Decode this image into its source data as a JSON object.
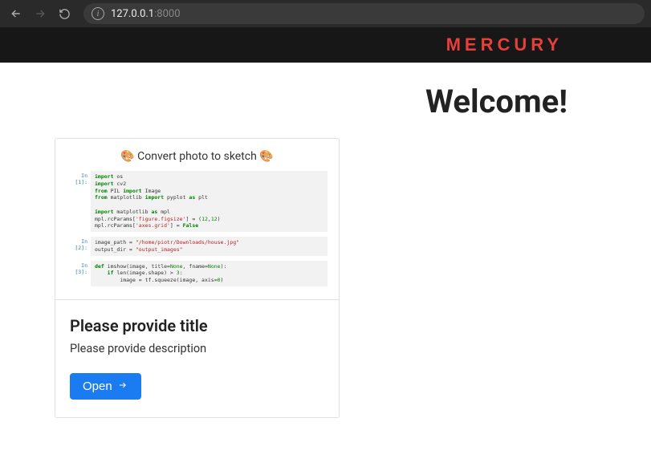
{
  "browser": {
    "url_host": "127.0.0.1",
    "url_port": ":8000"
  },
  "header": {
    "logo": "MERCURY"
  },
  "main": {
    "welcome": "Welcome!"
  },
  "card": {
    "notebook_title": "🎨 Convert photo to sketch 🎨",
    "cells": [
      {
        "prompt": "In [1]:"
      },
      {
        "prompt": "In [2]:"
      },
      {
        "prompt": "In [3]:"
      }
    ],
    "title": "Please provide title",
    "description": "Please provide description",
    "open_label": "Open"
  },
  "code": {
    "c1_l1a": "import",
    "c1_l1b": " os",
    "c1_l2a": "import",
    "c1_l2b": " cv2",
    "c1_l3a": "from",
    "c1_l3b": " PIL ",
    "c1_l3c": "import",
    "c1_l3d": " Image",
    "c1_l4a": "from",
    "c1_l4b": " matplotlib ",
    "c1_l4c": "import",
    "c1_l4d": " pyplot ",
    "c1_l4e": "as",
    "c1_l4f": " plt",
    "c1_l5": "",
    "c1_l6a": "import",
    "c1_l6b": " matplotlib ",
    "c1_l6c": "as",
    "c1_l6d": " mpl",
    "c1_l7a": "mpl.rcParams[",
    "c1_l7b": "'figure.figsize'",
    "c1_l7c": "] = (",
    "c1_l7d": "12",
    "c1_l7e": ",",
    "c1_l7f": "12",
    "c1_l7g": ")",
    "c1_l8a": "mpl.rcParams[",
    "c1_l8b": "'axes.grid'",
    "c1_l8c": "] = ",
    "c1_l8d": "False",
    "c2_l1a": "image_path = ",
    "c2_l1b": "\"/home/piotr/Downloads/house.jpg\"",
    "c2_l2a": "output_dir = ",
    "c2_l2b": "\"output_images\"",
    "c3_l1a": "def",
    "c3_l1b": " imshow(image, title=",
    "c3_l1c": "None",
    "c3_l1d": ", fname=",
    "c3_l1e": "None",
    "c3_l1f": "):",
    "c3_l2a": "    if",
    "c3_l2b": " len(image.shape) > ",
    "c3_l2c": "3",
    "c3_l2d": ":",
    "c3_l3a": "        image = tf.squeeze(image, axis=",
    "c3_l3b": "0",
    "c3_l3c": ")"
  }
}
